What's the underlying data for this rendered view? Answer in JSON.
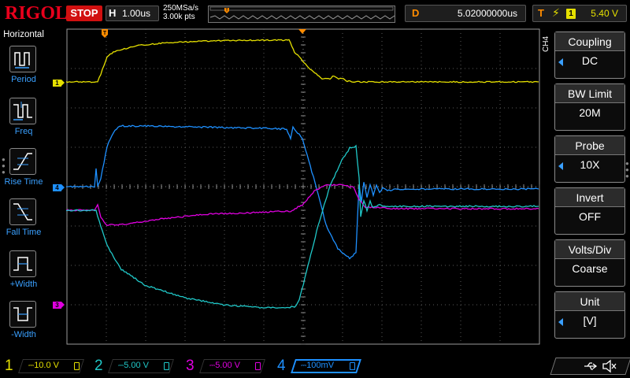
{
  "topbar": {
    "brand": "RIGOL",
    "run_state": "STOP",
    "horizontal_letter": "H",
    "timebase": "1.00us",
    "sample_rate": "250MSa/s",
    "memory_depth": "3.00k pts",
    "delay_letter": "D",
    "delay": "5.02000000us",
    "trigger_letter": "T",
    "trigger_source": "1",
    "trigger_level": "5.40 V"
  },
  "left_menu": {
    "title": "Horizontal",
    "items": [
      {
        "label": "Period",
        "icon": "period-icon"
      },
      {
        "label": "Freq",
        "icon": "freq-icon"
      },
      {
        "label": "Rise Time",
        "icon": "rise-time-icon"
      },
      {
        "label": "Fall Time",
        "icon": "fall-time-icon"
      },
      {
        "label": "+Width",
        "icon": "pos-width-icon"
      },
      {
        "label": "-Width",
        "icon": "neg-width-icon"
      }
    ]
  },
  "right_menu": {
    "channel": "CH4",
    "items": [
      {
        "title": "Coupling",
        "value": "DC"
      },
      {
        "title": "BW Limit",
        "value": "20M"
      },
      {
        "title": "Probe",
        "value": "10X"
      },
      {
        "title": "Invert",
        "value": "OFF"
      },
      {
        "title": "Volts/Div",
        "value": "Coarse"
      },
      {
        "title": "Unit",
        "value": "[V]"
      }
    ]
  },
  "channels": [
    {
      "id": "1",
      "scale": "10.0 V",
      "color": "#e5e000"
    },
    {
      "id": "2",
      "scale": "5.00 V",
      "color": "#20c8c8"
    },
    {
      "id": "3",
      "scale": "5.00 V",
      "color": "#e000e0"
    },
    {
      "id": "4",
      "scale": "100mV",
      "color": "#1e90ff"
    }
  ],
  "markers": {
    "ch1": "1",
    "ch4": "4",
    "ch3": "3",
    "trigger_time": "T"
  },
  "colors": {
    "accent_blue": "#3aa0ff",
    "trigger_orange": "#ff8c00",
    "stop_red": "#d11010",
    "brand_red": "#e8001c"
  }
}
